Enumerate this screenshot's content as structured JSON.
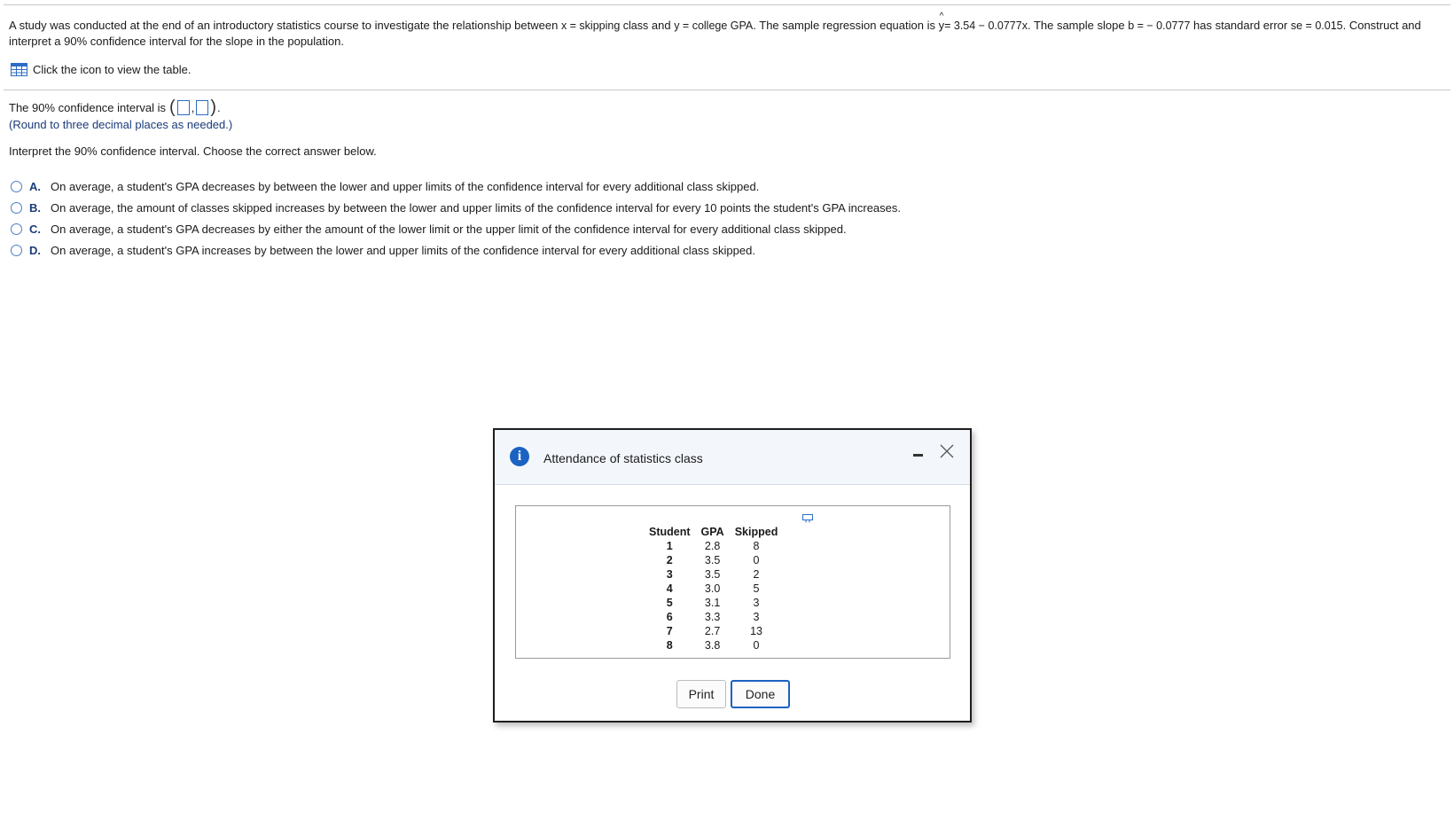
{
  "question": {
    "part1": "A study was conducted at the end of an introductory statistics course to investigate the relationship between",
    "xvar": "x = skipping class",
    "and": "and",
    "yvar": "y = college GPA",
    "part2": ". The sample regression equation is",
    "y_letter": "y",
    "equation_rest": "= 3.54 − 0.0777x",
    "part3": ". The sample slope",
    "slope": "b = − 0.0777",
    "part4": "has standard error",
    "se": "se = 0.015",
    "part5": ". Construct and interpret a 90% confidence interval for the slope in the population."
  },
  "table_link": "Click the icon to view the table.",
  "ci": {
    "label": "The 90% confidence interval is",
    "round_note": "(Round to three decimal places as needed.)"
  },
  "interpret_prompt": "Interpret the 90% confidence interval. Choose the correct answer below.",
  "options": [
    {
      "letter": "A.",
      "text": "On average, a student's GPA decreases by between the lower and upper limits of the confidence interval for every additional class skipped."
    },
    {
      "letter": "B.",
      "text": "On average, the amount of classes skipped increases by between the lower and upper limits of the confidence interval for every 10 points the student's GPA increases."
    },
    {
      "letter": "C.",
      "text": "On average, a student's GPA decreases by either the amount of the lower limit or the upper limit of the confidence interval for every additional class skipped."
    },
    {
      "letter": "D.",
      "text": "On average, a student's GPA increases by between the lower and upper limits of the confidence interval for every additional class skipped."
    }
  ],
  "dialog": {
    "title": "Attendance of statistics class",
    "columns": [
      "Student",
      "GPA",
      "Skipped"
    ],
    "rows": [
      [
        "1",
        "2.8",
        "8"
      ],
      [
        "2",
        "3.5",
        "0"
      ],
      [
        "3",
        "3.5",
        "2"
      ],
      [
        "4",
        "3.0",
        "5"
      ],
      [
        "5",
        "3.1",
        "3"
      ],
      [
        "6",
        "3.3",
        "3"
      ],
      [
        "7",
        "2.7",
        "13"
      ],
      [
        "8",
        "3.8",
        "0"
      ]
    ],
    "print_label": "Print",
    "done_label": "Done"
  },
  "colors": {
    "accent": "#1b62c2",
    "header_bg": "#f3f7fc",
    "note_text": "#1a3a7a"
  }
}
